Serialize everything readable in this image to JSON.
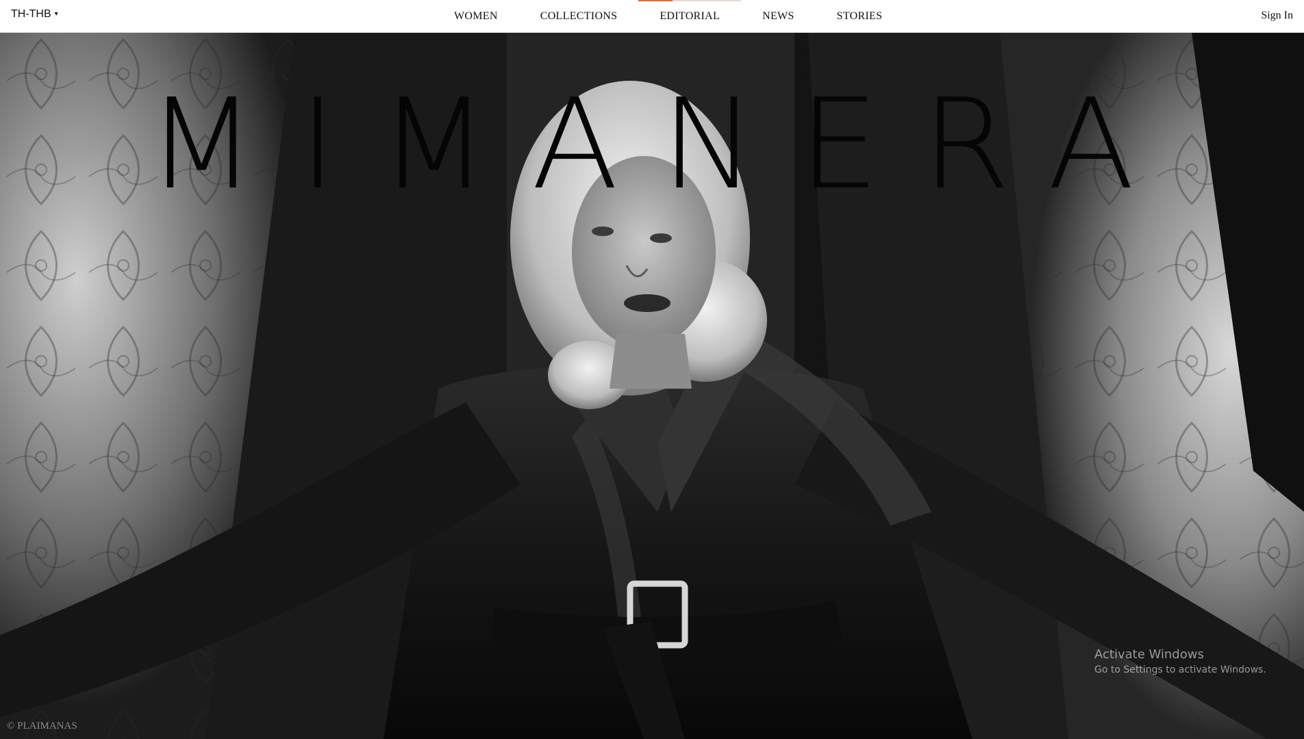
{
  "header": {
    "locale": {
      "label": "TH-THB",
      "caret": "▾"
    },
    "nav": [
      {
        "label": "WOMEN"
      },
      {
        "label": "COLLECTIONS"
      },
      {
        "label": "EDITORIAL"
      },
      {
        "label": "NEWS"
      },
      {
        "label": "STORIES"
      }
    ],
    "active_nav_index": 2,
    "sign_in": "Sign In"
  },
  "hero": {
    "brand": "MIMANERA",
    "credit": "© PLAIMANAS",
    "image": "black-and-white editorial photo of a blonde woman in a belted black leather trench coat"
  },
  "os_watermark": {
    "title": "Activate Windows",
    "subtitle": "Go to Settings to activate Windows."
  },
  "colors": {
    "header_bg": "#ffffff",
    "text": "#111111",
    "accent": "#e06a3a",
    "credit": "#8a8a8a"
  }
}
